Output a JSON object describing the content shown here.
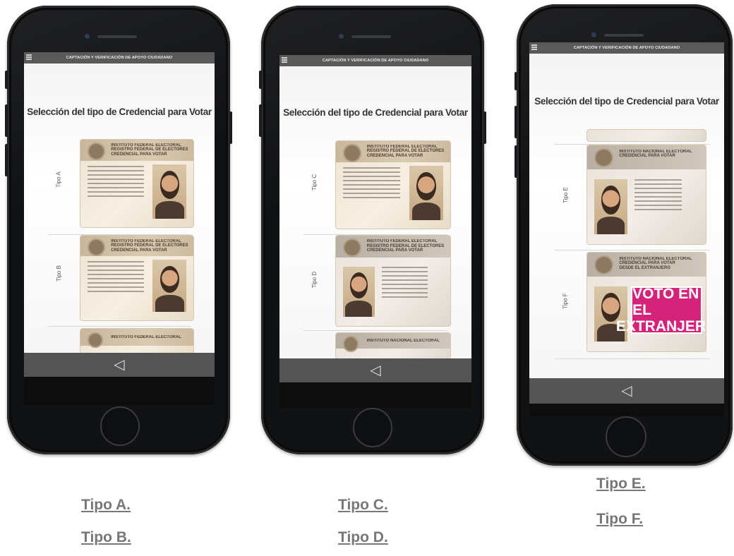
{
  "app_header": {
    "title": "CAPTACIÓN Y VERIFICACIÓN DE APOYO CIUDADANO"
  },
  "screen": {
    "page_title": "Selección del tipo de Credencial para Votar"
  },
  "phones": [
    {
      "rows": [
        {
          "label": "Tipo A",
          "card_header": "INSTITUTO FEDERAL ELECTORAL",
          "card_sub1": "REGISTRO FEDERAL DE ELECTORES",
          "card_sub2": "CREDENCIAL PARA VOTAR"
        },
        {
          "label": "Tipo B",
          "card_header": "INSTITUTO FEDERAL ELECTORAL",
          "card_sub1": "REGISTRO FEDERAL DE ELECTORES",
          "card_sub2": "CREDENCIAL PARA VOTAR"
        },
        {
          "label": "",
          "card_header": "INSTITUTO FEDERAL ELECTORAL"
        }
      ]
    },
    {
      "rows": [
        {
          "label": "Tipo C",
          "card_header": "INSTITUTO FEDERAL ELECTORAL",
          "card_sub1": "REGISTRO FEDERAL DE ELECTORES",
          "card_sub2": "CREDENCIAL PARA VOTAR"
        },
        {
          "label": "Tipo D",
          "card_header": "INSTITUTO FEDERAL ELECTORAL",
          "card_sub1": "REGISTRO FEDERAL DE ELECTORES",
          "card_sub2": "CREDENCIAL PARA VOTAR"
        },
        {
          "label": "",
          "card_header": "INSTITUTO NACIONAL ELECTORAL"
        }
      ]
    },
    {
      "rows": [
        {
          "label": "Tipo E",
          "card_header": "INSTITUTO NACIONAL ELECTORAL",
          "card_sub1": "CREDENCIAL PARA VOTAR"
        },
        {
          "label": "Tipo F",
          "card_header": "INSTITUTO NACIONAL ELECTORAL",
          "card_sub1": "CREDENCIAL PARA VOTAR",
          "card_sub2": "DESDE EL EXTRANJERO"
        }
      ],
      "voto_line1": "VOTO EN EL",
      "voto_line2": "EXTRANJERO"
    }
  ],
  "captions": {
    "tipo_a": "Tipo A.",
    "tipo_b": "Tipo B.",
    "tipo_c": "Tipo C.",
    "tipo_d": "Tipo D.",
    "tipo_e": "Tipo E.",
    "tipo_f": "Tipo F."
  },
  "icons": {
    "menu": "hamburger-menu-icon",
    "back": "back-triangle-icon",
    "home": "home-button"
  },
  "colors": {
    "phone_body": "#111214",
    "app_bar": "#5a5a5a",
    "nav_bar": "#545454",
    "caption": "#777777",
    "voto_magenta": "#d6237a"
  }
}
